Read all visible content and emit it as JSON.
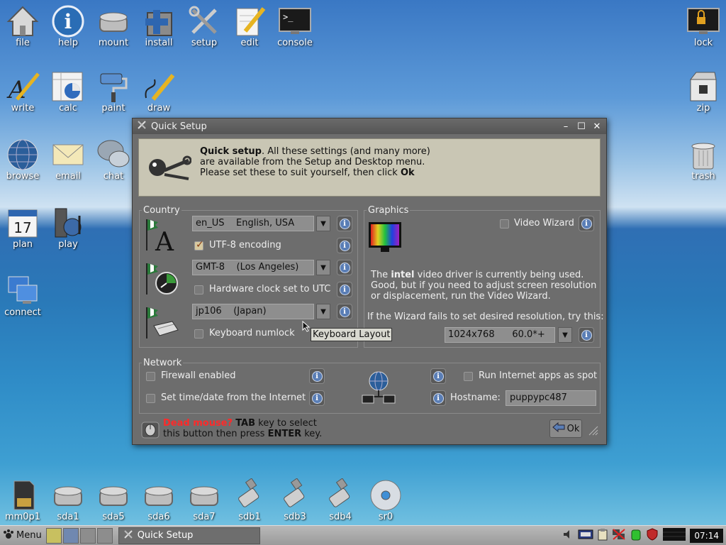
{
  "desktop": {
    "top_icons": [
      {
        "id": "file",
        "label": "file"
      },
      {
        "id": "help",
        "label": "help"
      },
      {
        "id": "mount",
        "label": "mount"
      },
      {
        "id": "install",
        "label": "install"
      },
      {
        "id": "setup",
        "label": "setup"
      },
      {
        "id": "edit",
        "label": "edit"
      },
      {
        "id": "console",
        "label": "console"
      }
    ],
    "row2_icons": [
      {
        "label": "write"
      },
      {
        "label": "calc"
      },
      {
        "label": "paint"
      },
      {
        "label": "draw"
      }
    ],
    "left_icons": [
      {
        "label": "browse"
      },
      {
        "label": "email"
      },
      {
        "label": "chat"
      },
      {
        "label": "plan"
      },
      {
        "label": "play"
      },
      {
        "label": "connect"
      }
    ],
    "right_icons": [
      {
        "label": "lock"
      },
      {
        "label": "zip"
      },
      {
        "label": "trash"
      }
    ],
    "drives": [
      {
        "label": "mm0p1"
      },
      {
        "label": "sda1"
      },
      {
        "label": "sda5"
      },
      {
        "label": "sda6"
      },
      {
        "label": "sda7"
      },
      {
        "label": "sdb1"
      },
      {
        "label": "sdb3"
      },
      {
        "label": "sdb4"
      },
      {
        "label": "sr0"
      }
    ],
    "calendar_day": "17"
  },
  "window": {
    "title": "Quick Setup",
    "banner": {
      "bold": "Quick setup",
      "line1_rest": ". All these settings (and many more)",
      "line2": "are available from the Setup and Desktop menu.",
      "line3_pre": "Please set these to suit yourself, then click ",
      "line3_bold": "Ok"
    },
    "country": {
      "legend": "Country",
      "locale": "en_US    English, USA",
      "utf8_label": "UTF-8 encoding",
      "utf8_checked": true,
      "timezone": "GMT-8    (Los Angeles)",
      "hwclock_label": "Hardware clock set to UTC",
      "hwclock_checked": false,
      "keyboard": "jp106    (Japan)",
      "numlock_label": "Keyboard numlock",
      "numlock_checked": false
    },
    "graphics": {
      "legend": "Graphics",
      "video_wizard_label": "Video Wizard",
      "desc_pre": "The ",
      "desc_bold": "intel",
      "desc_rest": " video driver is currently being used.",
      "desc2": "Good, but if you need to adjust screen resolution",
      "desc3": "or displacement, run the Video Wizard.",
      "fail_text": "If the Wizard fails to set desired resolution, try this:",
      "resolution": "1024x768      60.0*+"
    },
    "network": {
      "legend": "Network",
      "firewall_label": "Firewall enabled",
      "settime_label": "Set time/date from the Internet",
      "spot_label": "Run Internet apps as spot",
      "hostname_label": "Hostname:",
      "hostname": "puppypc487"
    },
    "footer": {
      "dead": "Dead mouse?",
      "tab": "TAB",
      "text1": " key to select",
      "text2_pre": "this button then press ",
      "enter": "ENTER",
      "text2_post": " key."
    },
    "ok_label": "Ok",
    "tooltip": "Keyboard Layout"
  },
  "taskbar": {
    "menu_label": "Menu",
    "task_label": "Quick Setup",
    "clock": "07:14"
  }
}
